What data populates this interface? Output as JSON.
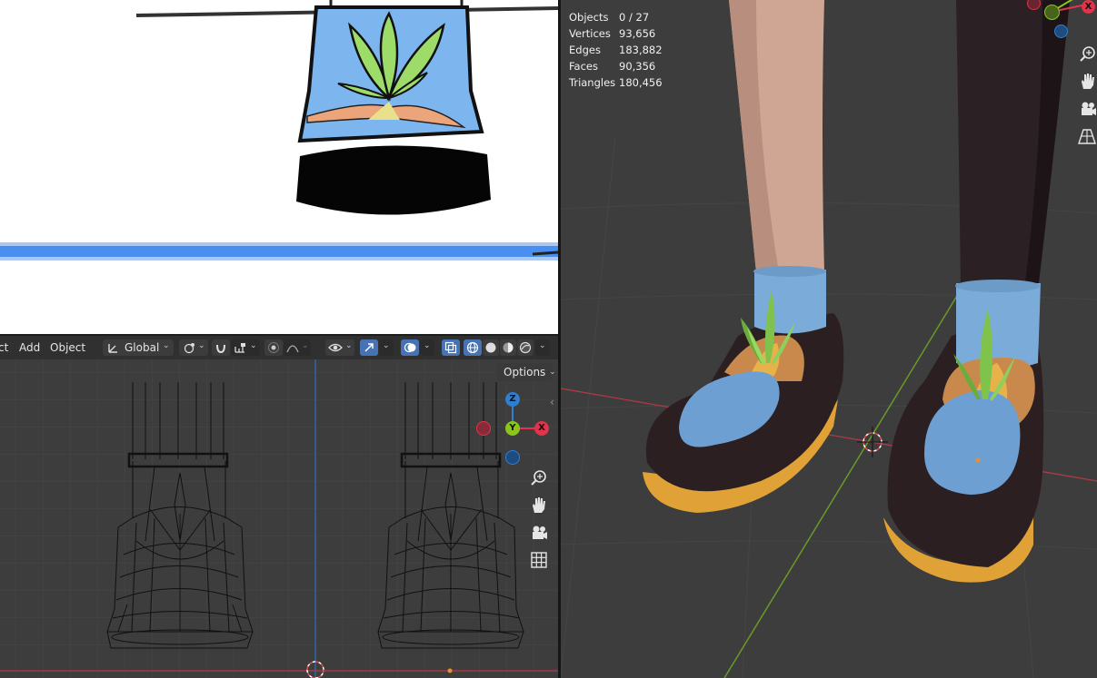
{
  "left_header": {
    "menu_partial": "ct",
    "menu_add": "Add",
    "menu_object": "Object",
    "orientation": "Global",
    "options": "Options"
  },
  "gizmo_left": {
    "z": "Z",
    "y": "Y",
    "x": "X"
  },
  "gizmo_right": {
    "x": "X"
  },
  "stats": {
    "objects_label": "Objects",
    "objects_value": "0 / 27",
    "vertices_label": "Vertices",
    "vertices_value": "93,656",
    "edges_label": "Edges",
    "edges_value": "183,882",
    "faces_label": "Faces",
    "faces_value": "90,356",
    "triangles_label": "Triangles",
    "triangles_value": "180,456"
  },
  "colors": {
    "axis_x": "#e0344c",
    "axis_y": "#8bc51c",
    "axis_z": "#2f7fd0",
    "active_blue": "#4772b3",
    "sock_blue": "#7eb4e6",
    "leaf_green": "#8ed468",
    "shoe_dark": "#2a1d20",
    "sole_orange": "#e4a83a"
  }
}
